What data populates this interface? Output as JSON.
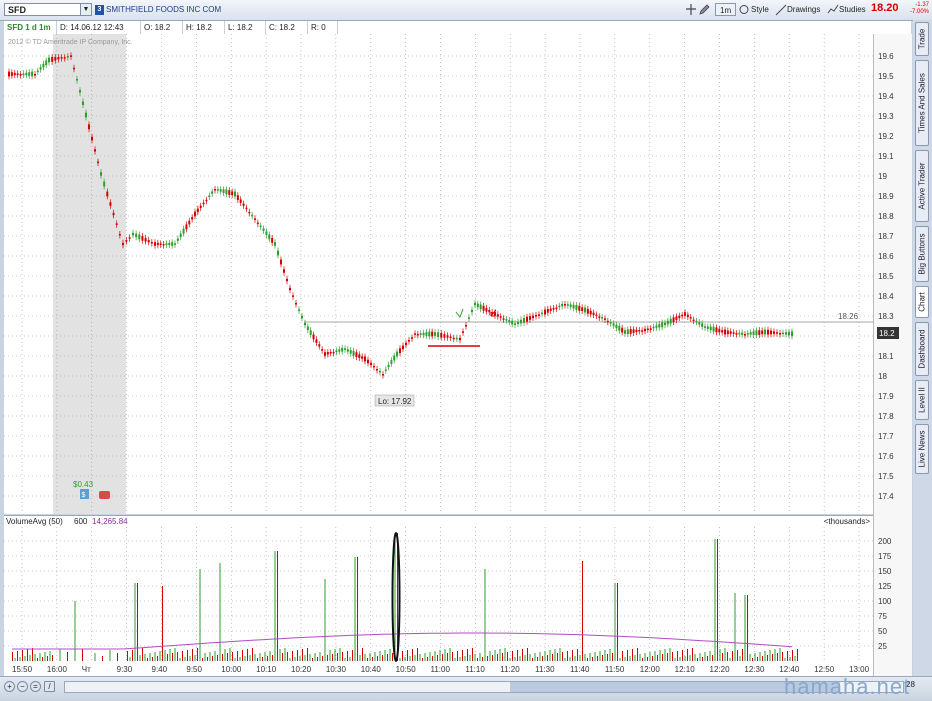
{
  "header": {
    "symbol": "SFD",
    "link_badge": "3",
    "company": "SMITHFIELD FOODS INC COM",
    "interval_label": "1m",
    "style_label": "Style",
    "drawings_label": "Drawings",
    "studies_label": "Studies",
    "last_price": "18.20",
    "change": "-1.37",
    "change_pct": "-7.00%"
  },
  "infobar": {
    "chart_id": "SFD 1 d 1m",
    "date": "D: 14.06.12 12:43",
    "open": "O: 18.2",
    "high": "H: 18.2",
    "low": "L: 18.2",
    "close": "C: 18.2",
    "range": "R: 0"
  },
  "copyright": "2012 © TD Ameritrade IP Company, Inc.",
  "price_axis": {
    "ticks": [
      "19.6",
      "19.5",
      "19.4",
      "19.3",
      "19.2",
      "19.1",
      "19",
      "18.9",
      "18.8",
      "18.7",
      "18.6",
      "18.5",
      "18.4",
      "18.3",
      "18.2",
      "18.1",
      "18",
      "17.9",
      "17.8",
      "17.7",
      "17.6",
      "17.5",
      "17.4"
    ],
    "last_tag": "18.2",
    "ref_line_label": "18.26"
  },
  "annotations": {
    "low_label": "Lo: 17.92",
    "dividend": "$0.43"
  },
  "volume": {
    "study_name": "VolumeAvg (50)",
    "length": "600",
    "avg_value": "14,265.84",
    "units": "<thousands>",
    "ticks": [
      "200",
      "175",
      "150",
      "125",
      "100",
      "75",
      "50",
      "25"
    ]
  },
  "time_axis": [
    "15:50",
    "16:00",
    "Чт",
    "9:30",
    "9:40",
    "9:50",
    "10:00",
    "10:10",
    "10:20",
    "10:30",
    "10:40",
    "10:50",
    "11:00",
    "11:10",
    "11:20",
    "11:30",
    "11:40",
    "11:50",
    "12:00",
    "12:10",
    "12:20",
    "12:30",
    "12:40",
    "12:50",
    "13:00"
  ],
  "side_tabs": [
    "Trade",
    "Times And Sales",
    "Active Trader",
    "Big Buttons",
    "Chart",
    "Dashboard",
    "Level II",
    "Live News"
  ],
  "bottom": {
    "page_num": "28"
  },
  "watermark": "hamaha.net",
  "colors": {
    "up": "#2e9e2e",
    "down": "#d60000",
    "background": "#ffffff",
    "accent": "#d10000"
  }
}
